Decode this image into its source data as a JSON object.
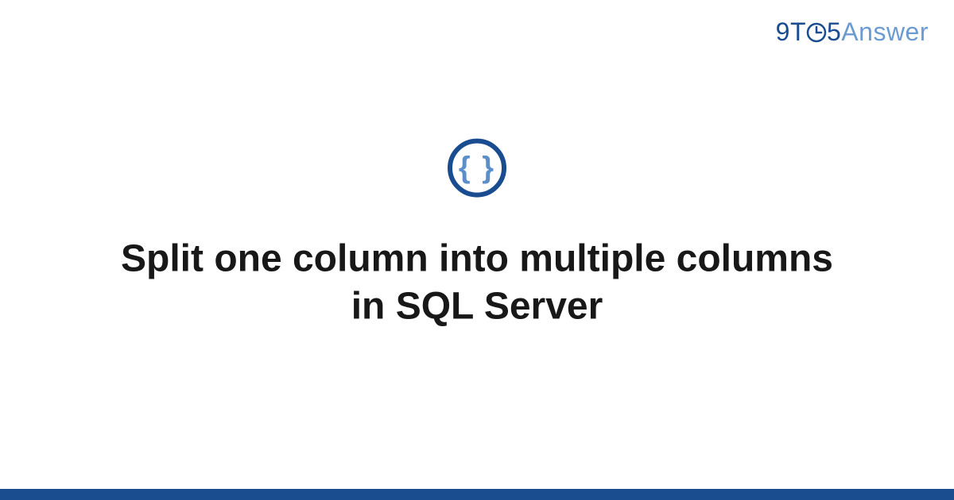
{
  "logo": {
    "prefix": "9T",
    "middle": "5",
    "suffix": "Answer"
  },
  "icon": {
    "content": "{ }"
  },
  "title": "Split one column into multiple columns in SQL Server"
}
